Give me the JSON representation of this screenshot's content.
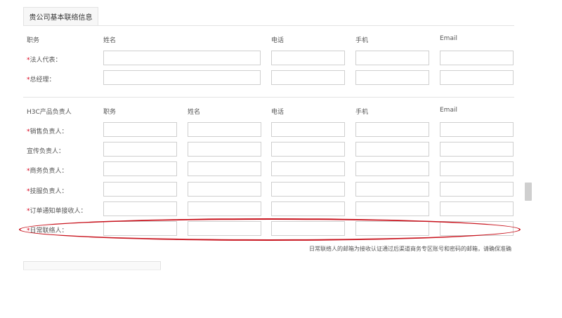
{
  "section": {
    "title": "贵公司基本联络信息"
  },
  "part1": {
    "headers": [
      "职务",
      "姓名",
      "电话",
      "手机",
      "Email"
    ],
    "rows": [
      {
        "required": "*",
        "label": "法人代表："
      },
      {
        "required": "*",
        "label": "总经理："
      }
    ]
  },
  "part2": {
    "headers": [
      "H3C产品负责人",
      "职务",
      "姓名",
      "电话",
      "手机",
      "Email"
    ],
    "rows": [
      {
        "required": "*",
        "label": "销售负责人："
      },
      {
        "required": "",
        "label": "宣传负责人："
      },
      {
        "required": "*",
        "label": "商务负责人："
      },
      {
        "required": "*",
        "label": "技服负责人："
      },
      {
        "required": "*",
        "label": "订单通知单接收人："
      },
      {
        "required": "*",
        "label": "日常联络人："
      }
    ]
  },
  "hint": "日常联络人的邮箱为接收认证通过后渠道商务专区账号和密码的邮箱，请确保准确",
  "colors": {
    "required": "#d9001b",
    "highlight": "#c8141e",
    "border": "#cfcfcf"
  }
}
